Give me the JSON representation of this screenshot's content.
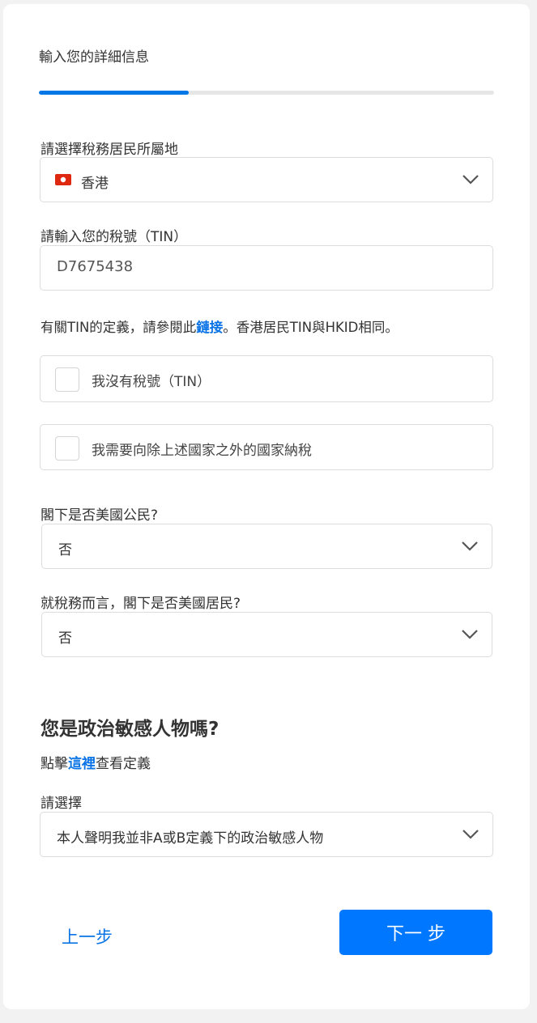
{
  "page": {
    "title": "輸入您的詳細信息",
    "progress_percent": 33
  },
  "tax_residence": {
    "label": "請選擇稅務居民所屬地",
    "value": "香港",
    "flag_color": "#de2910"
  },
  "tin": {
    "label": "請輸入您的稅號（TIN）",
    "value": "D7675438"
  },
  "note": {
    "prefix": "有關TIN的定義，請參閱此",
    "link": "鏈接",
    "suffix": "。香港居民TIN與HKID相同。"
  },
  "checkboxes": [
    {
      "label": "我沒有稅號（TIN）",
      "checked": false
    },
    {
      "label": "我需要向除上述國家之外的國家納稅",
      "checked": false
    }
  ],
  "us_citizen": {
    "label": "閣下是否美國公民?",
    "value": "否"
  },
  "us_resident": {
    "label": "就稅務而言，閣下是否美國居民?",
    "value": "否"
  },
  "pep": {
    "heading": "您是政治敏感人物嗎?",
    "sub_prefix": "點擊",
    "sub_link": "這裡",
    "sub_suffix": "查看定義",
    "label": "請選擇",
    "value": "本人聲明我並非A或B定義下的政治敏感人物"
  },
  "nav": {
    "back_label": "上一步",
    "next_label": "下一 步"
  },
  "colors": {
    "accent": "#0077ff",
    "link": "#0a73e6"
  }
}
